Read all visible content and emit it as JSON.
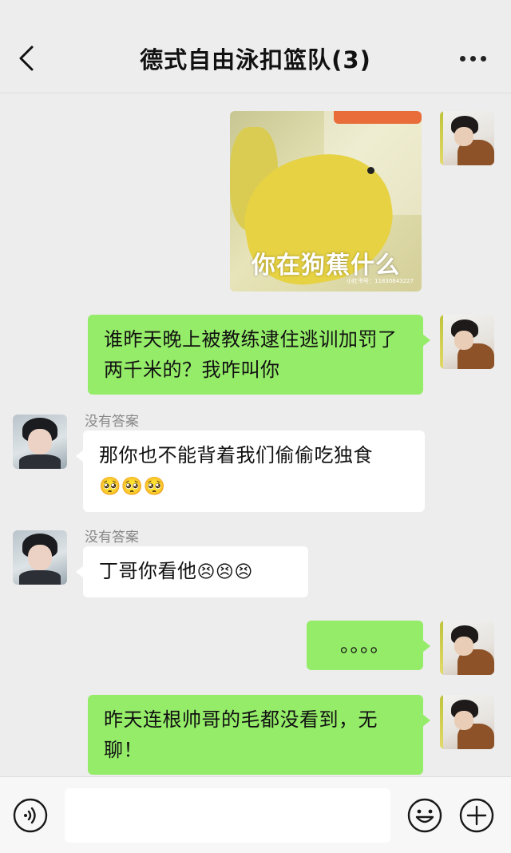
{
  "header": {
    "title": "德式自由泳扣篮队(3)",
    "back_icon": "chevron-left-icon",
    "more_icon": "more-dots-icon"
  },
  "messages": [
    {
      "type": "image",
      "from": "me",
      "caption": "你在狗蕉什么",
      "watermark": "小红书号：11830843227"
    },
    {
      "type": "text",
      "from": "me",
      "text": "谁昨天晚上被教练逮住逃训加罚了两千米的？我咋叫你"
    },
    {
      "type": "text",
      "from": "other",
      "sender": "没有答案",
      "text": "那你也不能背着我们偷偷吃独食",
      "emoji": "🥺🥺🥺"
    },
    {
      "type": "text",
      "from": "other",
      "sender": "没有答案",
      "text": "丁哥你看他",
      "emoji": "😣😣😣"
    },
    {
      "type": "text",
      "from": "me",
      "text": "。。。。"
    },
    {
      "type": "text",
      "from": "me",
      "text": "昨天连根帅哥的毛都没看到，无聊！"
    }
  ],
  "input_bar": {
    "voice_icon": "voice-icon",
    "emoji_icon": "emoji-icon",
    "plus_icon": "plus-icon",
    "placeholder": ""
  },
  "colors": {
    "background": "#ededed",
    "my_bubble": "#95ec69",
    "other_bubble": "#ffffff"
  }
}
